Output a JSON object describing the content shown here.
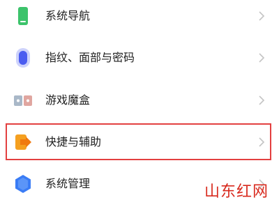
{
  "settings": {
    "items": [
      {
        "label": "系统导航",
        "icon": "phone-navigation-icon",
        "icon_color": "#3cc36b"
      },
      {
        "label": "指纹、面部与密码",
        "icon": "fingerprint-icon",
        "icon_color": "#4a5cf0"
      },
      {
        "label": "游戏魔盒",
        "icon": "game-box-icon",
        "icon_color": "#e0a6a0"
      },
      {
        "label": "快捷与辅助",
        "icon": "shortcut-arrow-icon",
        "icon_color": "#f5a020",
        "highlighted": true
      },
      {
        "label": "系统管理",
        "icon": "hexagon-system-icon",
        "icon_color": "#3a7cf5"
      }
    ],
    "chevron_icon": "chevron-right-icon"
  },
  "highlight": {
    "color": "#e34040"
  },
  "watermark": {
    "text": "山东红网",
    "color": "#d82a1e"
  }
}
